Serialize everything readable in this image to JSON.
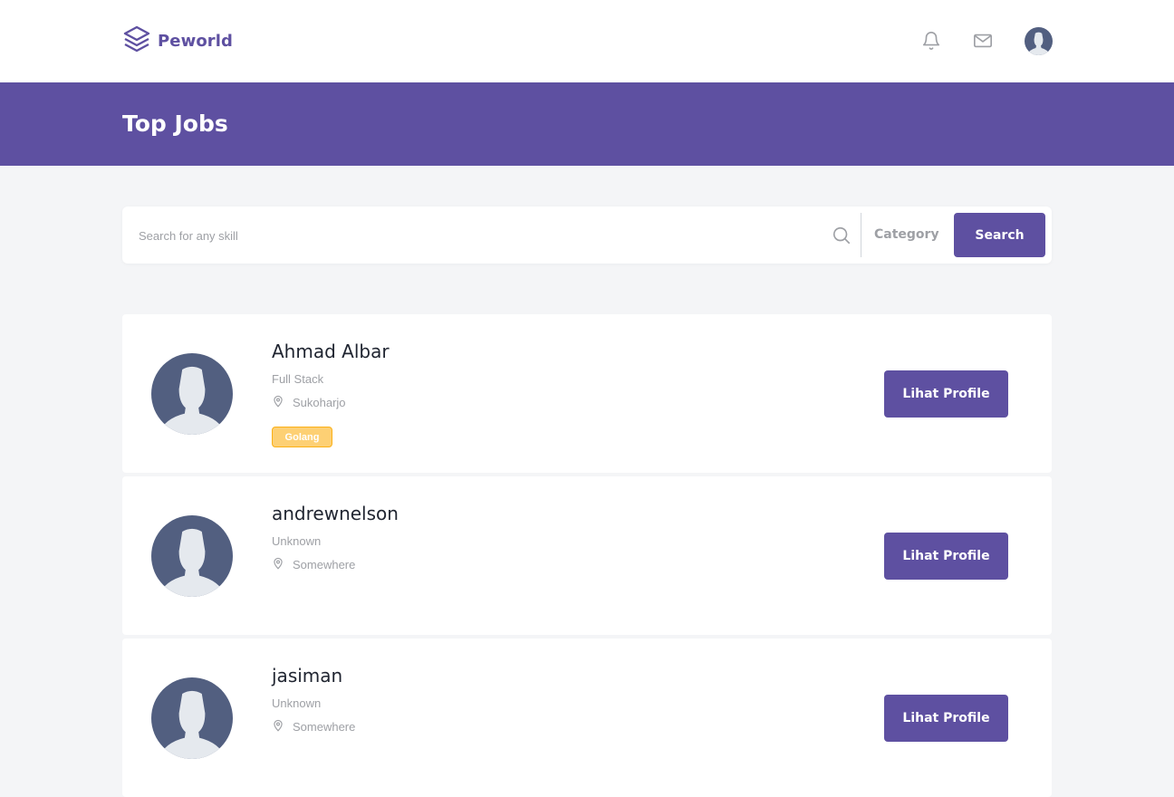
{
  "brand": {
    "name": "Peworld",
    "color": "#5e50a1"
  },
  "nav": {
    "icons": [
      "bell-icon",
      "mail-icon",
      "user-avatar"
    ]
  },
  "header": {
    "title": "Top Jobs"
  },
  "search": {
    "placeholder": "Search for any skill",
    "value": "",
    "category_label": "Category",
    "button_label": "Search"
  },
  "candidates": [
    {
      "name": "Ahmad Albar",
      "job": "Full Stack",
      "location": "Sukoharjo",
      "skills": [
        "Golang"
      ],
      "button_label": "Lihat Profile"
    },
    {
      "name": "andrewnelson",
      "job": "Unknown",
      "location": "Somewhere",
      "skills": [],
      "button_label": "Lihat Profile"
    },
    {
      "name": "jasiman",
      "job": "Unknown",
      "location": "Somewhere",
      "skills": [],
      "button_label": "Lihat Profile"
    }
  ],
  "colors": {
    "primary": "#5e50a1",
    "background": "#f4f5f7",
    "muted_text": "#9ea0a5",
    "skill_badge": "#fbb017",
    "avatar_bg": "#525f80",
    "avatar_figure": "#e5e9ee"
  }
}
